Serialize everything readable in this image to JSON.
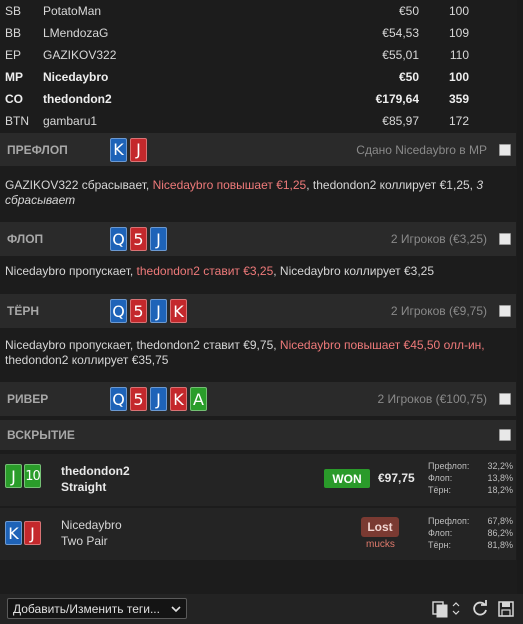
{
  "players": [
    {
      "pos": "SB",
      "name": "PotatoMan",
      "stack": "€50",
      "bb": "100",
      "bold": false
    },
    {
      "pos": "BB",
      "name": "LMendozaG",
      "stack": "€54,53",
      "bb": "109",
      "bold": false
    },
    {
      "pos": "EP",
      "name": "GAZIKOV322",
      "stack": "€55,01",
      "bb": "110",
      "bold": false
    },
    {
      "pos": "MP",
      "name": "Nicedaybro",
      "stack": "€50",
      "bb": "100",
      "bold": true
    },
    {
      "pos": "CO",
      "name": "thedondon2",
      "stack": "€179,64",
      "bb": "359",
      "bold": true
    },
    {
      "pos": "BTN",
      "name": "gambaru1",
      "stack": "€85,97",
      "bb": "172",
      "bold": false
    }
  ],
  "preflop": {
    "label": "ПРЕФЛОП",
    "cards": [
      {
        "rank": "K",
        "suit": "s"
      },
      {
        "rank": "J",
        "suit": "h"
      }
    ],
    "info": "Сдано Nicedaybro в MP",
    "actions": [
      {
        "text": "GAZIKOV322 сбрасывает, ",
        "style": ""
      },
      {
        "text": "Nicedaybro повышает €1,25",
        "style": "hl"
      },
      {
        "text": ", thedondon2 коллирует €1,25, ",
        "style": ""
      },
      {
        "text": "3 сбрасывает",
        "style": "it"
      }
    ]
  },
  "flop": {
    "label": "ФЛОП",
    "cards": [
      {
        "rank": "Q",
        "suit": "s"
      },
      {
        "rank": "5",
        "suit": "h"
      },
      {
        "rank": "J",
        "suit": "s"
      }
    ],
    "info": "2 Игроков (€3,25)",
    "actions": [
      {
        "text": "Nicedaybro пропускает, ",
        "style": ""
      },
      {
        "text": "thedondon2 ставит €3,25",
        "style": "hl"
      },
      {
        "text": ", Nicedaybro коллирует €3,25",
        "style": ""
      }
    ]
  },
  "turn": {
    "label": "ТЁРН",
    "cards": [
      {
        "rank": "Q",
        "suit": "s"
      },
      {
        "rank": "5",
        "suit": "h"
      },
      {
        "rank": "J",
        "suit": "s"
      },
      {
        "rank": "K",
        "suit": "h"
      }
    ],
    "info": "2 Игроков (€9,75)",
    "actions": [
      {
        "text": "Nicedaybro пропускает, thedondon2 ставит €9,75, ",
        "style": ""
      },
      {
        "text": "Nicedaybro повышает €45,50 олл-ин,",
        "style": "hl"
      },
      {
        "text": " thedondon2 коллирует €35,75",
        "style": ""
      }
    ]
  },
  "river": {
    "label": "РИВЕР",
    "cards": [
      {
        "rank": "Q",
        "suit": "s"
      },
      {
        "rank": "5",
        "suit": "h"
      },
      {
        "rank": "J",
        "suit": "s"
      },
      {
        "rank": "K",
        "suit": "h"
      },
      {
        "rank": "A",
        "suit": "c"
      }
    ],
    "info": "2 Игроков (€100,75)"
  },
  "showdown": {
    "label": "ВСКРЫТИЕ"
  },
  "results": [
    {
      "cards": [
        {
          "rank": "J",
          "suit": "c"
        },
        {
          "rank": "10",
          "suit": "c"
        }
      ],
      "name": "thedondon2",
      "hand": "Straight",
      "badge": "WON",
      "amount": "€97,75",
      "stats": [
        {
          "label": "Префлоп:",
          "value": "32,2%"
        },
        {
          "label": "Флоп:",
          "value": "13,8%"
        },
        {
          "label": "Тёрн:",
          "value": "18,2%"
        }
      ]
    },
    {
      "cards": [
        {
          "rank": "K",
          "suit": "s"
        },
        {
          "rank": "J",
          "suit": "h"
        }
      ],
      "name": "Nicedaybro",
      "hand": "Two Pair",
      "badge": "Lost",
      "note": "mucks",
      "stats": [
        {
          "label": "Префлоп:",
          "value": "67,8%"
        },
        {
          "label": "Флоп:",
          "value": "86,2%"
        },
        {
          "label": "Тёрн:",
          "value": "81,8%"
        }
      ]
    }
  ],
  "toolbar": {
    "tags_label": "Добавить/Изменить теги...",
    "icons": [
      "copy-icon",
      "refresh-icon",
      "save-icon"
    ]
  },
  "colors": {
    "spade": "#1e63b8",
    "heart": "#c4282c",
    "club": "#2a9d2a",
    "highlight": "#ef7a7a",
    "won": "#2a9a2a",
    "lost": "#7a3a32"
  }
}
